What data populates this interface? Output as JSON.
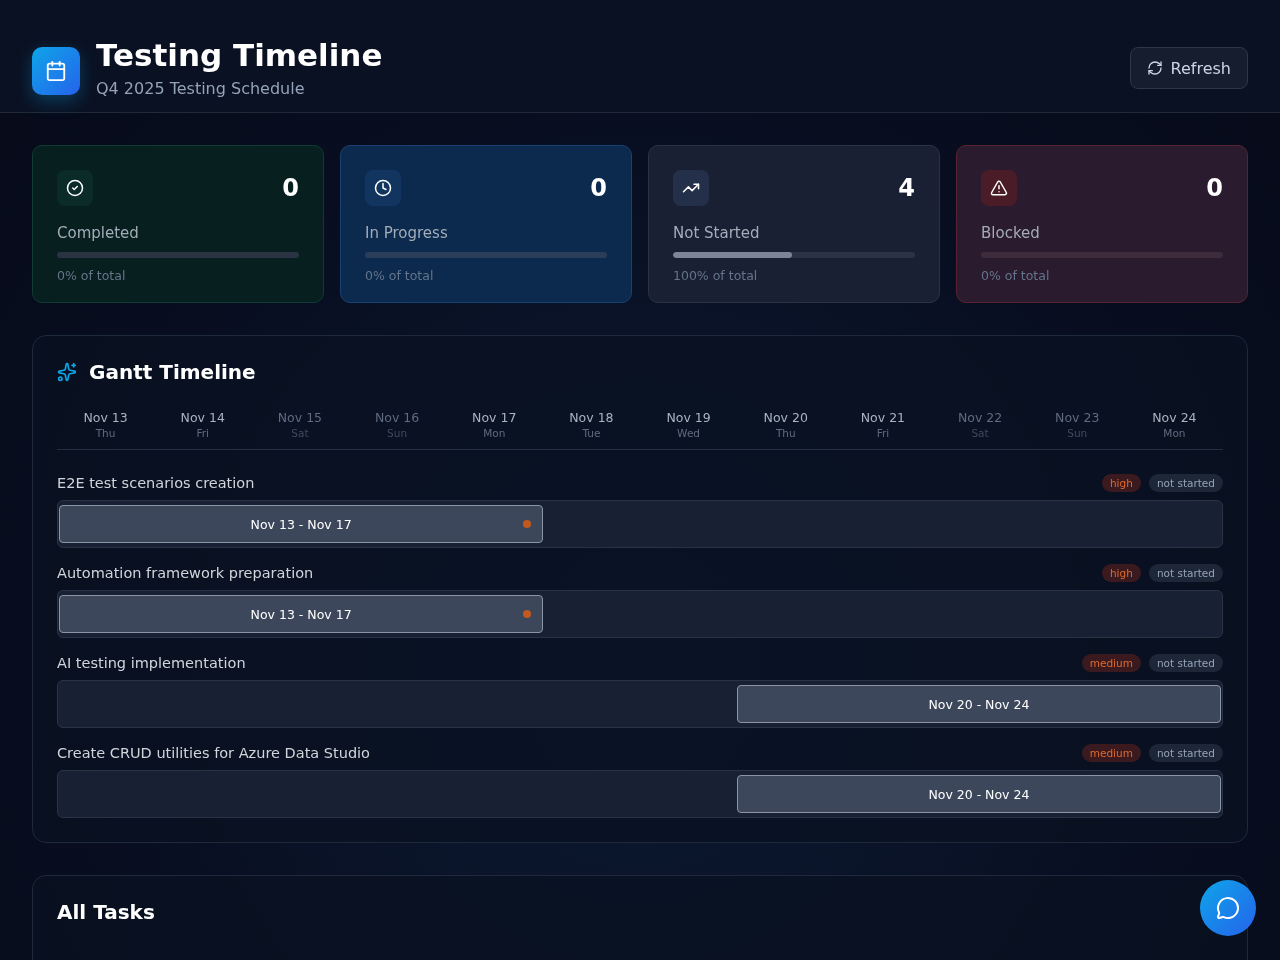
{
  "header": {
    "title": "Testing Timeline",
    "subtitle": "Q4 2025 Testing Schedule",
    "refresh_button": "Refresh"
  },
  "stats": [
    {
      "kind": "completed",
      "value": "0",
      "label": "Completed",
      "level": 0,
      "caption": "0% of total"
    },
    {
      "kind": "in_progress",
      "value": "0",
      "label": "In Progress",
      "level": 0,
      "caption": "0% of total"
    },
    {
      "kind": "not_started",
      "value": "4",
      "label": "Not Started",
      "level": 0.49,
      "caption": "100% of total"
    },
    {
      "kind": "blocked",
      "value": "0",
      "label": "Blocked",
      "level": 0,
      "caption": "0% of total"
    }
  ],
  "gantt": {
    "title": "Gantt Timeline",
    "days": [
      {
        "date": "Nov 13",
        "weekday": "Thu",
        "weekend": false
      },
      {
        "date": "Nov 14",
        "weekday": "Fri",
        "weekend": false
      },
      {
        "date": "Nov 15",
        "weekday": "Sat",
        "weekend": true
      },
      {
        "date": "Nov 16",
        "weekday": "Sun",
        "weekend": true
      },
      {
        "date": "Nov 17",
        "weekday": "Mon",
        "weekend": false
      },
      {
        "date": "Nov 18",
        "weekday": "Tue",
        "weekend": false
      },
      {
        "date": "Nov 19",
        "weekday": "Wed",
        "weekend": false
      },
      {
        "date": "Nov 20",
        "weekday": "Thu",
        "weekend": false
      },
      {
        "date": "Nov 21",
        "weekday": "Fri",
        "weekend": false
      },
      {
        "date": "Nov 22",
        "weekday": "Sat",
        "weekend": true
      },
      {
        "date": "Nov 23",
        "weekday": "Sun",
        "weekend": true
      },
      {
        "date": "Nov 24",
        "weekday": "Mon",
        "weekend": false
      }
    ],
    "tasks": [
      {
        "name": "E2E test scenarios creation",
        "priority": {
          "label": "high",
          "kind": "high"
        },
        "status": "not started",
        "range": "Nov 13 - Nov 17",
        "level": 0.4167,
        "at_end": false
      },
      {
        "name": "Automation framework preparation",
        "priority": {
          "label": "high",
          "kind": "high"
        },
        "status": "not started",
        "range": "Nov 13 - Nov 17",
        "level": 0.4167,
        "at_end": false
      },
      {
        "name": "AI testing implementation",
        "priority": {
          "label": "medium",
          "kind": "medium"
        },
        "status": "not started",
        "range": "Nov 20 - Nov 24",
        "level": 0.4167,
        "at_end": true
      },
      {
        "name": "Create CRUD utilities for Azure Data Studio",
        "priority": {
          "label": "medium",
          "kind": "medium"
        },
        "status": "not started",
        "range": "Nov 20 - Nov 24",
        "level": 0.4167,
        "at_end": true
      }
    ]
  },
  "all_tasks": {
    "title": "All Tasks"
  }
}
